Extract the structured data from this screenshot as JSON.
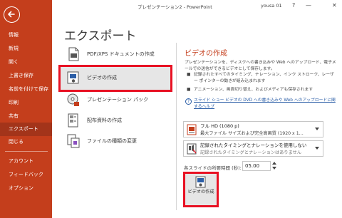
{
  "window": {
    "title": "プレゼンテーション2  -  PowerPoint",
    "user": "yousa 01",
    "help_glyph": "?",
    "minimize_glyph": "—",
    "close_glyph": "✕"
  },
  "sidebar": {
    "back_icon": "back-arrow-icon",
    "items": [
      {
        "label": "情報"
      },
      {
        "label": "新規"
      },
      {
        "label": "開く"
      },
      {
        "label": "上書き保存"
      },
      {
        "label": "名前を付けて保存"
      },
      {
        "label": "印刷"
      },
      {
        "label": "共有"
      },
      {
        "label": "エクスポート",
        "selected": true
      },
      {
        "label": "閉じる"
      },
      {
        "label": "アカウント"
      },
      {
        "label": "フィードバック"
      },
      {
        "label": "オプション"
      }
    ]
  },
  "main": {
    "title": "エクスポート",
    "options": [
      {
        "label": "PDF/XPS ドキュメントの作成",
        "icon": "pdf-document-icon"
      },
      {
        "label": "ビデオの作成",
        "icon": "video-icon",
        "selected": true
      },
      {
        "label": "プレゼンテーション パック",
        "icon": "package-cd-icon"
      },
      {
        "label": "配布資料の作成",
        "icon": "handout-icon"
      },
      {
        "label": "ファイルの種類の変更",
        "icon": "change-file-type-icon"
      }
    ]
  },
  "panel": {
    "title": "ビデオの作成",
    "description": "プレゼンテーションを、ディスクへの書き込みや Web へのアップロード、電子メールでの送信ができるビデオとして保存します。",
    "bullets": [
      "記録されたすべてのタイミング、ナレーション、インク ストローク、レーザー ポインターの動きが組み込まれます",
      "アニメーション、画面切り替え、およびメディアも保存されます"
    ],
    "help_link": "スライド ショー ビデオの DVD への書き込みや Web へのアップロードに関するヘルプ",
    "quality_dropdown": {
      "line1": "フル HD (1080 p)",
      "line2": "最大ファイル サイズおよび完全高画質 (1920 x 1…",
      "icon": "video-quality-icon"
    },
    "timing_dropdown": {
      "line1": "記録されたタイミングとナレーションを使用しない",
      "line2": "記録されたタイミングとナレーションはありません",
      "icon": "timing-narration-icon"
    },
    "seconds_label": "各スライドの所要時間 (秒):",
    "seconds_value": "05.00",
    "create_button": "ビデオの作成",
    "accent_color": "#c43e1c",
    "highlight_color": "#e81123"
  }
}
